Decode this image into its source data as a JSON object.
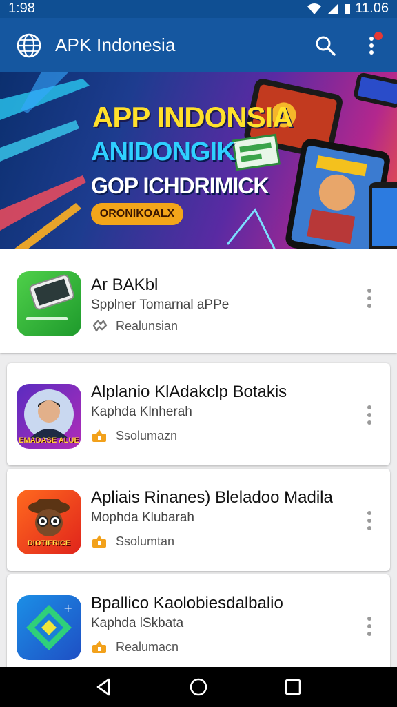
{
  "status_bar": {
    "time": "1:98",
    "clock_right": "11.06"
  },
  "app_bar": {
    "title": "APK Indonesia",
    "logo_icon": "globe-icon",
    "search_icon": "search-icon",
    "more_icon": "more-vert-icon"
  },
  "banner": {
    "line1": "APP INDONSIA",
    "line2": "ANIDONGIK",
    "line3": "GOP ICHDRIMICK",
    "pill": "ORONIKOALX"
  },
  "apps": [
    {
      "name": "Ar BAKbl",
      "subtitle": "Spplner Tomarnal aPPe",
      "meta": "Realunsian",
      "meta_icon": "puzzle-icon",
      "icon_theme": "green-phone"
    },
    {
      "name": "Alplanio KlAdakclp Botakis",
      "subtitle": "Kaphda Klnherah",
      "meta": "Ssolumazn",
      "meta_icon": "badge-icon",
      "icon_theme": "purple-person",
      "icon_caption": "EMADASE ALUE"
    },
    {
      "name": "Apliais Rinanes) Bleladoo Madila",
      "subtitle": "Mophda Klubarah",
      "meta": "Ssolumtan",
      "meta_icon": "badge-icon",
      "icon_theme": "orange-character",
      "icon_caption": "DIOTIFRICE"
    },
    {
      "name": "Bpallico Kaolobiesdalbalio",
      "subtitle": "Kaphda lSkbata",
      "meta": "Realumacn",
      "meta_icon": "badge-icon",
      "icon_theme": "blue-diamond"
    }
  ],
  "nav_bar": {
    "back": "back-icon",
    "home": "home-icon",
    "recents": "recents-icon"
  },
  "colors": {
    "app_bar": "#1557a0",
    "status_bar": "#0f4f93",
    "banner_yellow": "#ffe12b",
    "banner_cyan": "#2fd0ff",
    "pill": "#f3a51a"
  }
}
